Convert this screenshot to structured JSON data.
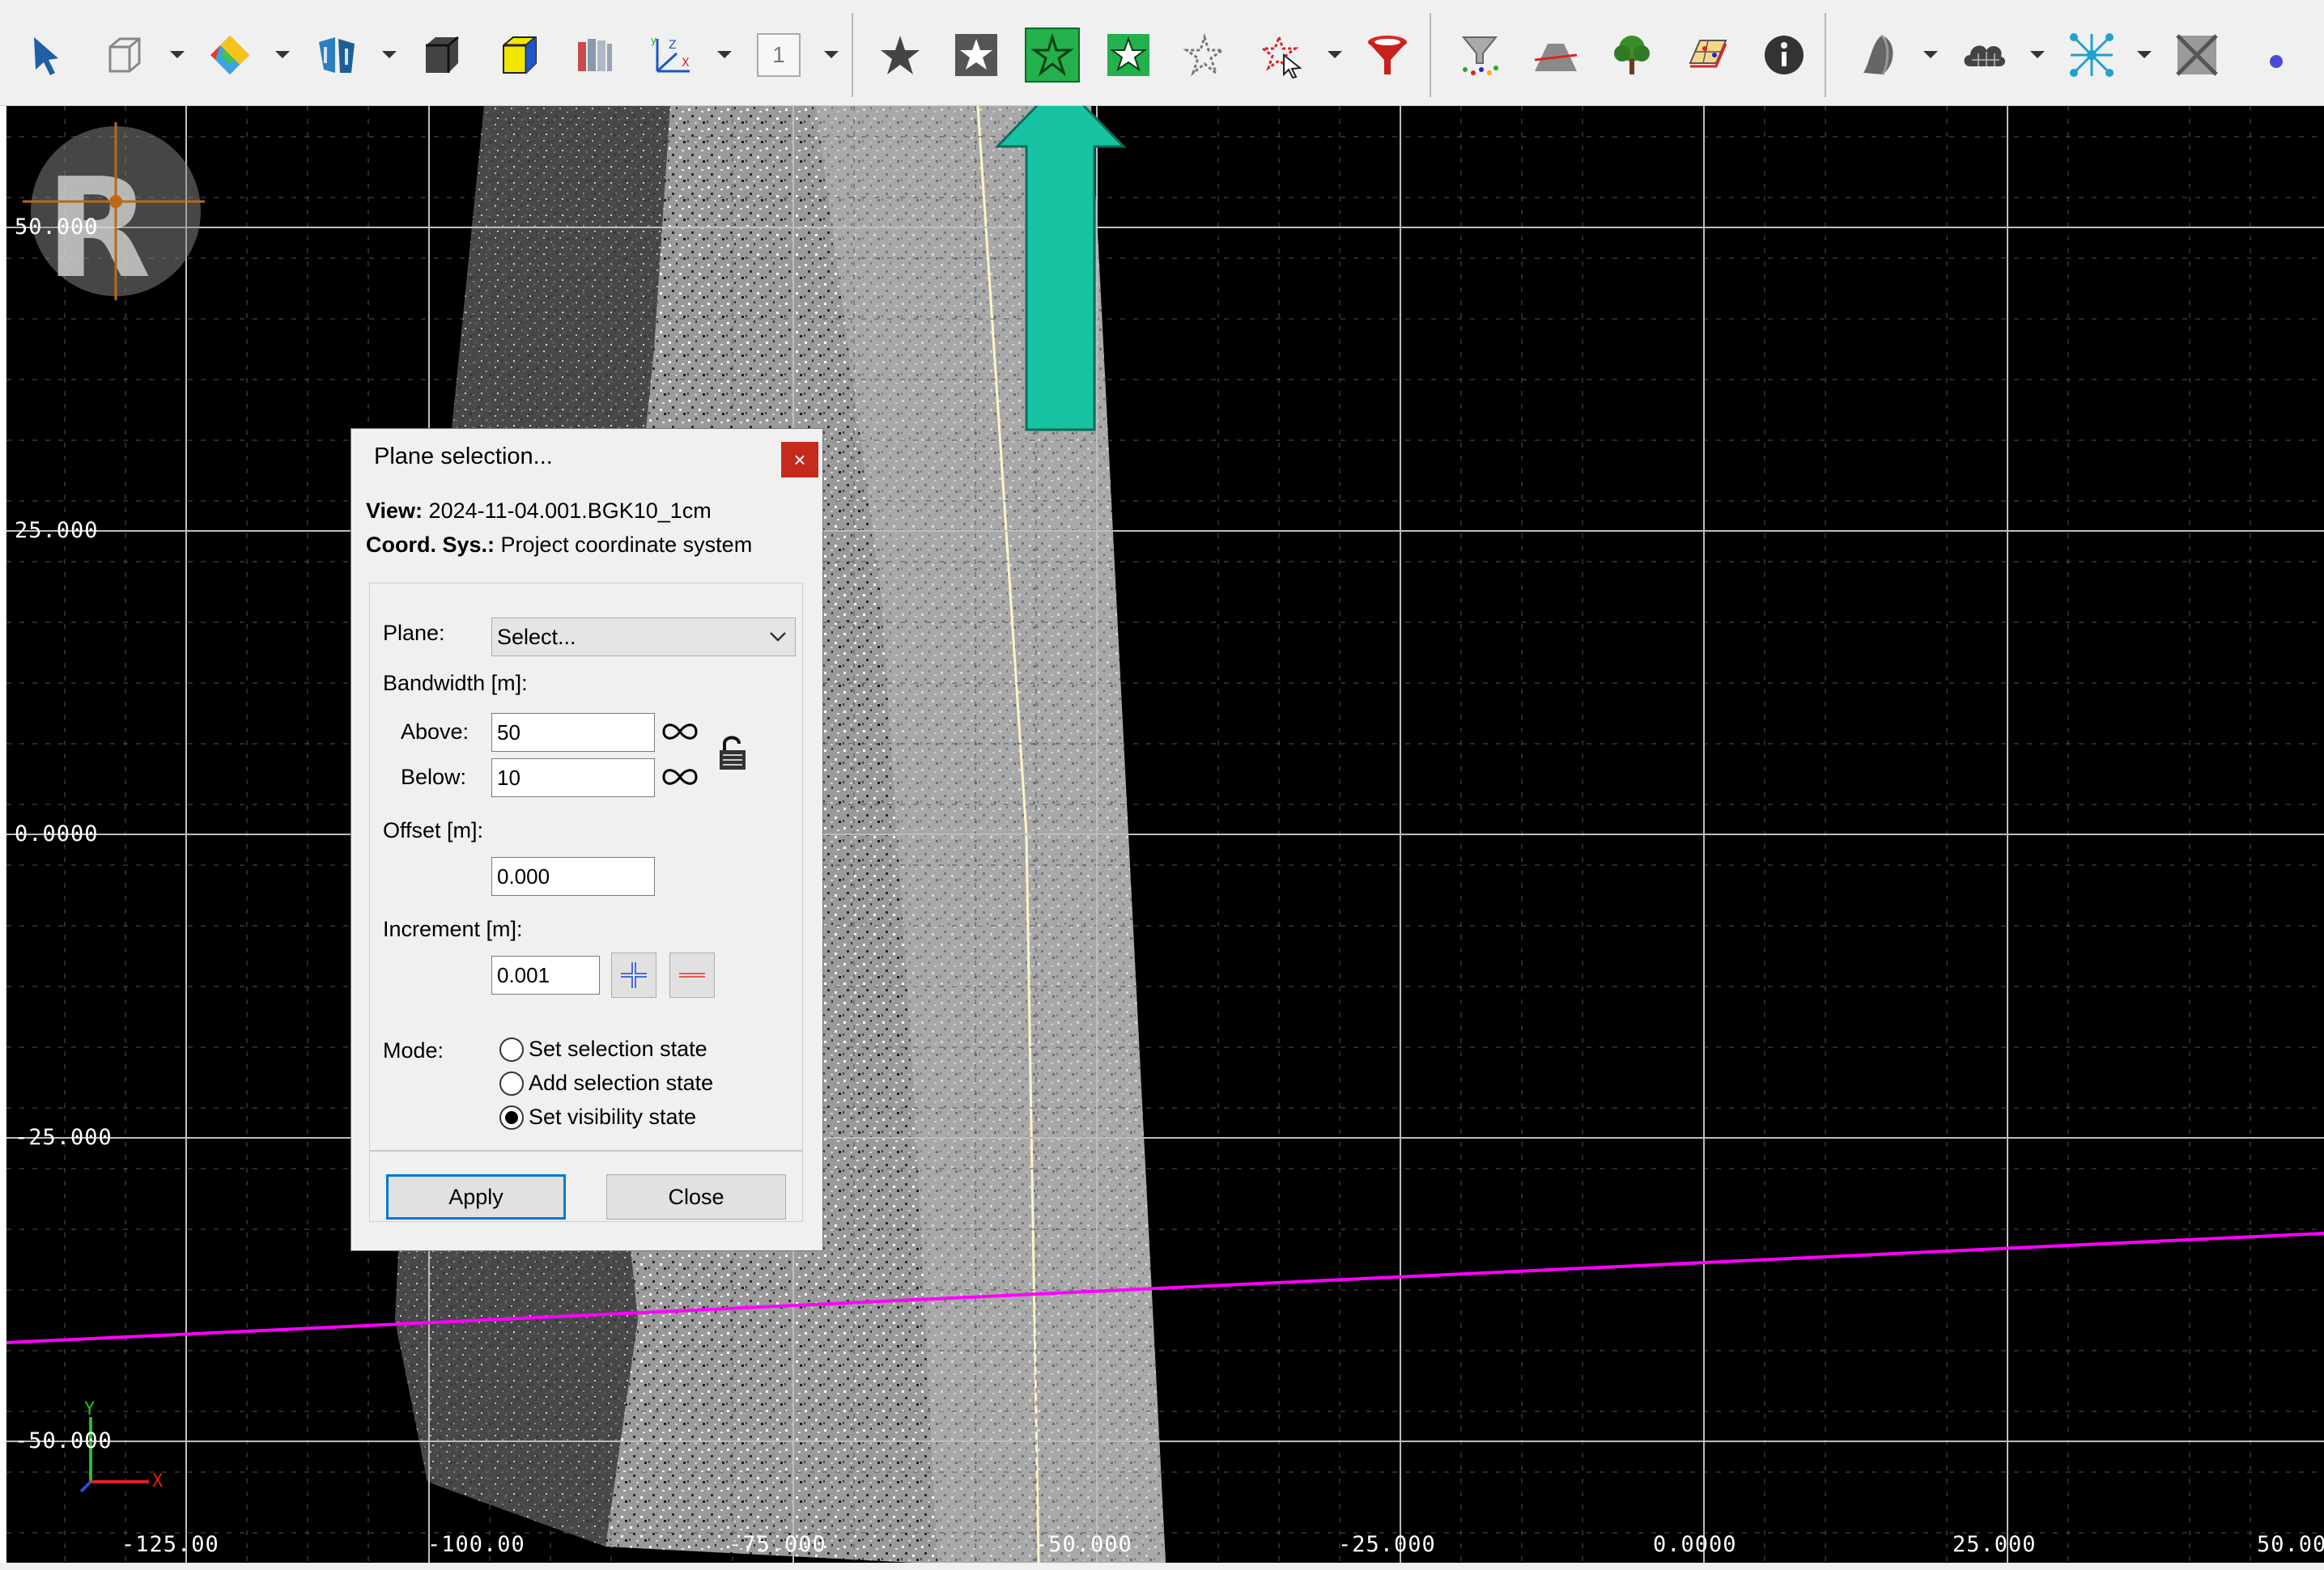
{
  "toolbar": {
    "icons": [
      "select-arrow-icon",
      "box-icon",
      "color-palette-icon",
      "buildings-icon",
      "cube-dark-icon",
      "cube-yellow-icon",
      "layers-icon",
      "coordinate-axes-icon",
      "number-one-icon",
      "star-select-icon",
      "star-box-select-icon",
      "plane-selection-icon",
      "star-add-icon",
      "star-dotted-icon",
      "star-pointer-icon",
      "filter-funnel-icon",
      "funnel-dots-icon",
      "terrain-profile-icon",
      "tree-icon",
      "grid-map-icon",
      "info-icon",
      "shape-3d-icon",
      "cloud-mesh-icon",
      "network-icon",
      "mesh-cross-icon",
      "dot-icon"
    ],
    "number_button_label": "1",
    "active_tool": "plane-selection-icon",
    "active_color": "#22b14c",
    "highlight_arrow_color": "#17c3a3"
  },
  "viewport": {
    "background": "#000000",
    "y_axis_labels": [
      "50.000",
      "25.000",
      "0.0000",
      "-25.000",
      "-50.000"
    ],
    "x_axis_labels": [
      "-125.00",
      "-100.00",
      "-75.000",
      "-50.000",
      "-25.000",
      "0.0000",
      "25.000",
      "50.00"
    ],
    "plane_line_color": "#ff00ff",
    "axes_indicator": {
      "y": "Y",
      "x": "X"
    }
  },
  "dialog": {
    "title": "Plane selection...",
    "close_label": "×",
    "view_label": "View:",
    "view_value": "2024-11-04.001.BGK10_1cm",
    "coord_label": "Coord. Sys.:",
    "coord_value": "Project coordinate system",
    "plane_label": "Plane:",
    "plane_value": "Select...",
    "bandwidth_label": "Bandwidth [m]:",
    "above_label": "Above:",
    "above_value": "50",
    "below_label": "Below:",
    "below_value": "10",
    "offset_label": "Offset [m]:",
    "offset_value": "0.000",
    "increment_label": "Increment [m]:",
    "increment_value": "0.001",
    "mode_label": "Mode:",
    "modes": [
      "Set selection state",
      "Add selection state",
      "Set visibility state"
    ],
    "selected_mode": "Set visibility state",
    "apply_label": "Apply",
    "close_button_label": "Close"
  }
}
